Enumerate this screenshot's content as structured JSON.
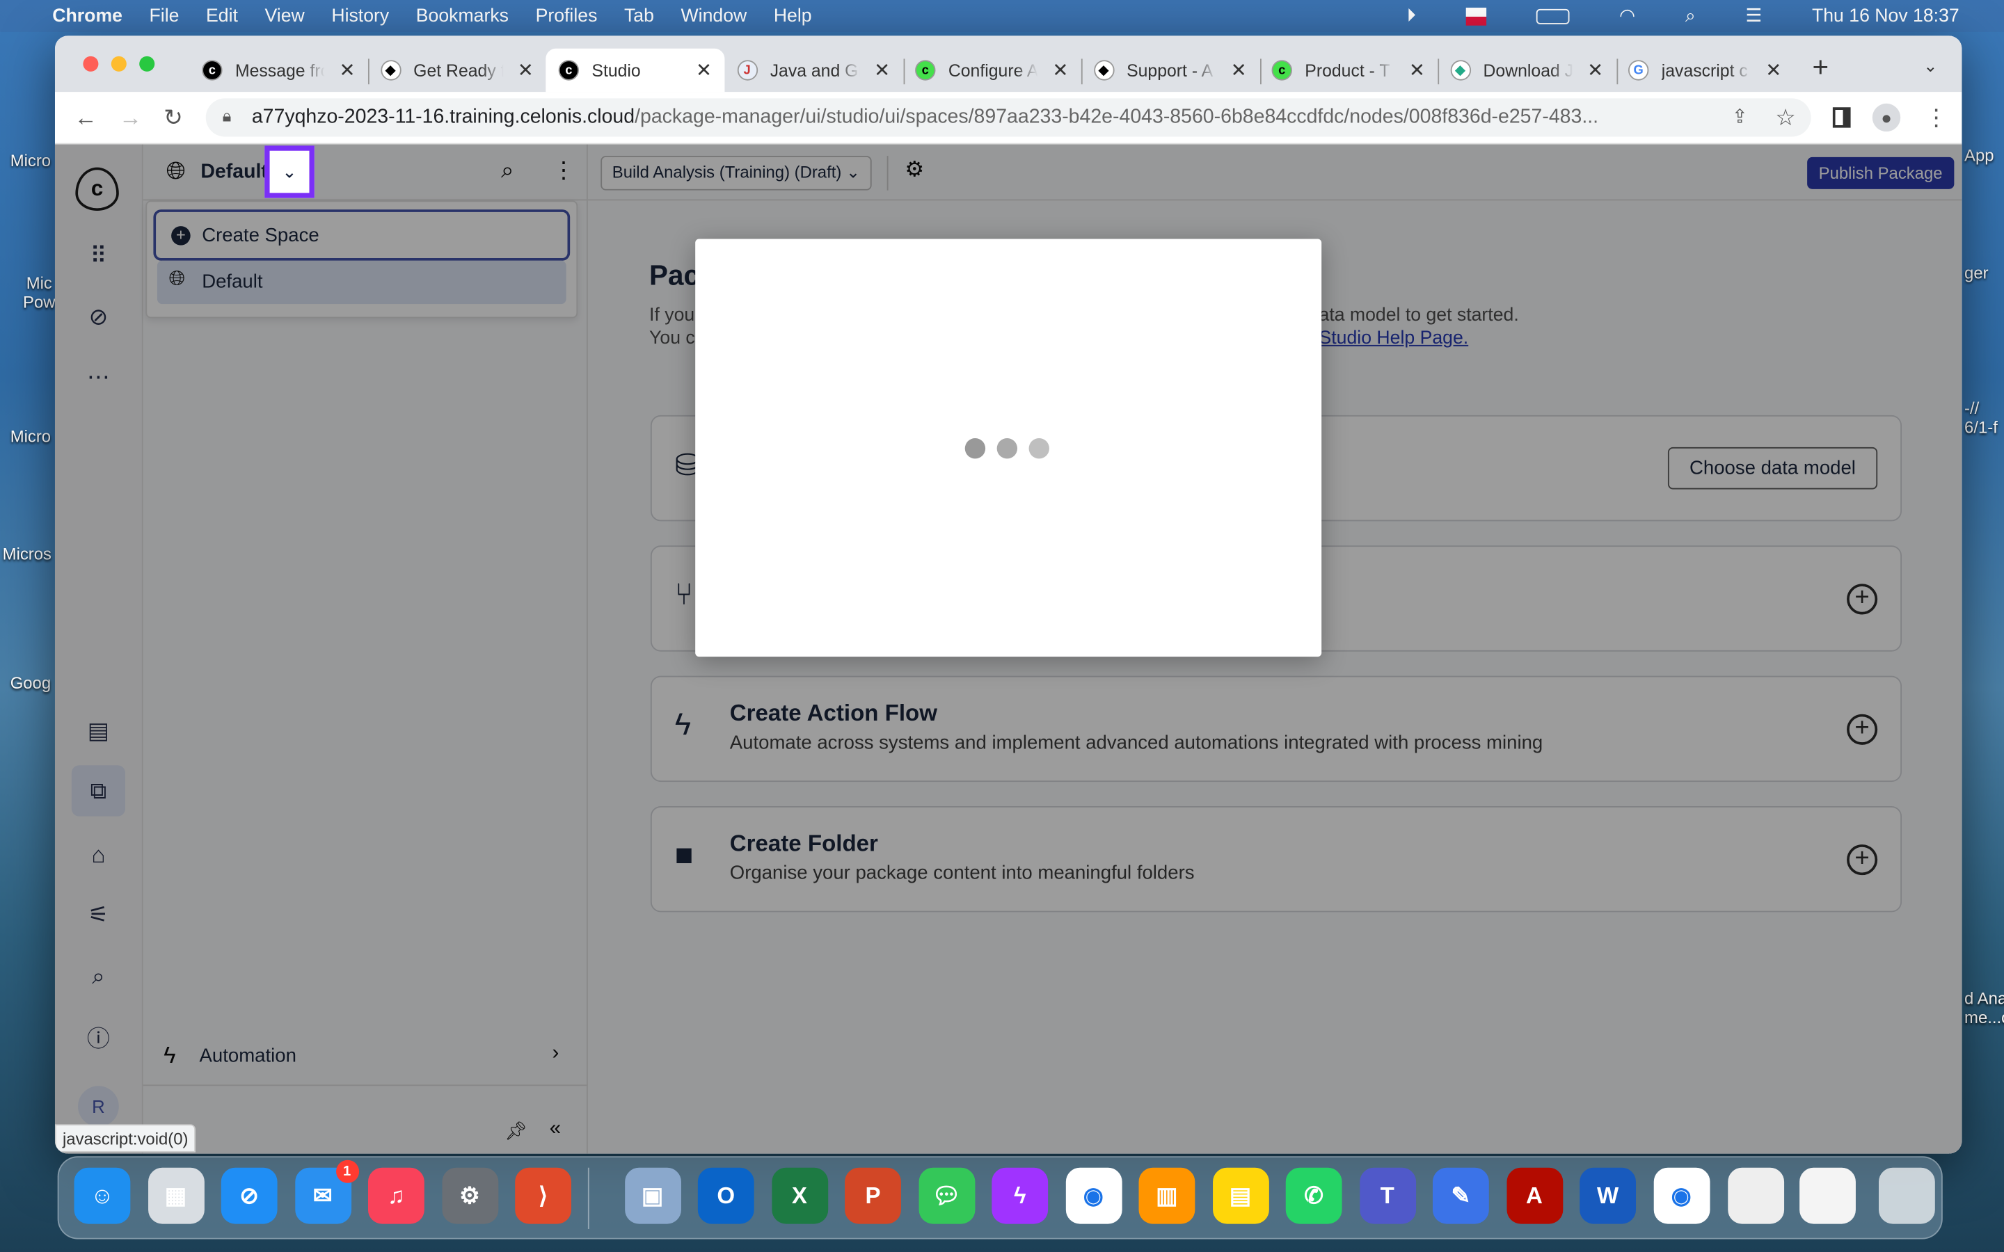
{
  "menubar": {
    "apple": "",
    "app": "Chrome",
    "items": [
      "File",
      "Edit",
      "View",
      "History",
      "Bookmarks",
      "Profiles",
      "Tab",
      "Window",
      "Help"
    ],
    "clock": "Thu 16 Nov  18:37"
  },
  "desktop": {
    "left_labels": [
      "Micro",
      "Mic\nPow",
      "Micro",
      "Micros",
      "Goog"
    ],
    "right_labels": [
      "App",
      "ger",
      "-//\n6/1-f",
      "d Ana\nme...c"
    ]
  },
  "browser": {
    "tabs": [
      {
        "label": "Message from",
        "icon": "celonis"
      },
      {
        "label": "Get Ready for",
        "icon": "academy"
      },
      {
        "label": "Studio",
        "icon": "celonis",
        "active": true
      },
      {
        "label": "Java and Gra",
        "icon": "java"
      },
      {
        "label": "Configure A",
        "icon": "celonis-green"
      },
      {
        "label": "Support - A",
        "icon": "academy"
      },
      {
        "label": "Product - T",
        "icon": "celonis-green"
      },
      {
        "label": "Download J",
        "icon": "download"
      },
      {
        "label": "javascript c",
        "icon": "google"
      }
    ],
    "url_host": "a77yqhzo-2023-11-16.training.celonis.cloud",
    "url_path": "/package-manager/ui/studio/ui/spaces/897aa233-b42e-4043-8560-6b8e84ccdfdc/nodes/008f836d-e257-483...",
    "status_text": "javascript:void(0)"
  },
  "app": {
    "space_name": "Default",
    "space_menu": {
      "create": "Create Space",
      "items": [
        "Default"
      ]
    },
    "automation": "Automation",
    "avatar": "R",
    "package_select": "Build Analysis (Training) (Draft)",
    "publish": "Publish Package",
    "title_fragment": "Pac",
    "intro_left": [
      "If you",
      "You c"
    ],
    "intro_right": [
      "ata model to get started.",
      "Studio Help Page."
    ],
    "cards": [
      {
        "title": "",
        "desc": "",
        "button": "Choose data model",
        "icon": "database-icon"
      },
      {
        "title": "",
        "desc": "",
        "icon": "flow-icon"
      },
      {
        "title": "Create Action Flow",
        "desc": "Automate across systems and implement advanced automations integrated with process mining",
        "icon": "lightning-icon"
      },
      {
        "title": "Create Folder",
        "desc": "Organise your package content into meaningful folders",
        "icon": "folder-icon"
      }
    ]
  },
  "modal": {
    "state": "loading"
  },
  "dock": {
    "apps": [
      "Finder",
      "Launchpad",
      "Safari",
      "Mail",
      "Music",
      "System Settings",
      "AnyDesk",
      "Preview",
      "Outlook",
      "Excel",
      "PowerPoint",
      "Messages",
      "Messenger",
      "Chrome",
      "Books",
      "Notes",
      "WhatsApp",
      "Teams",
      "Pencil",
      "Acrobat",
      "Word",
      "Chrome"
    ],
    "mail_badge": "1"
  },
  "colors": {
    "accent": "#1f2fa8",
    "highlight": "#7b2ff7",
    "link": "#1a2fb0"
  }
}
